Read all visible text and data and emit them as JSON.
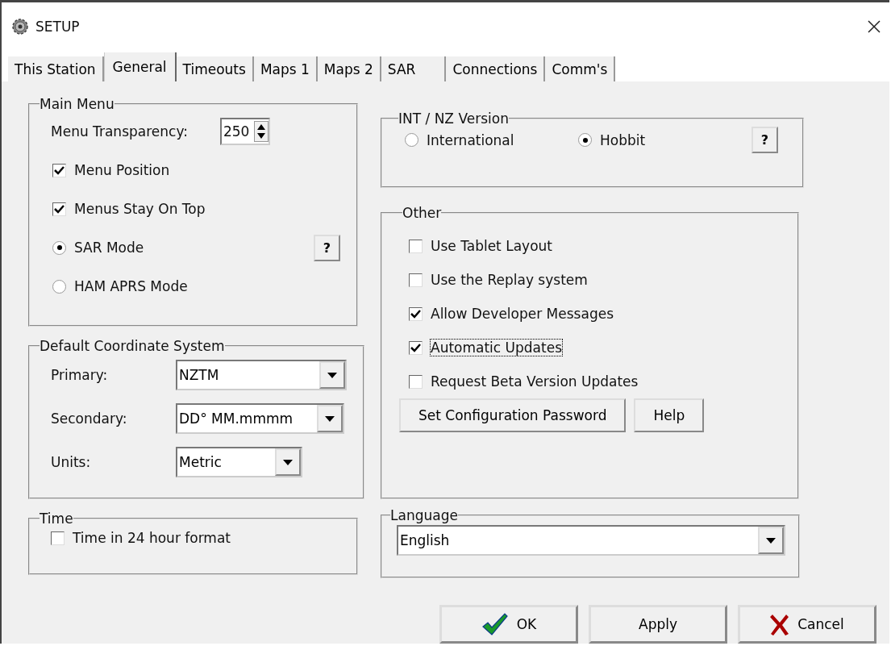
{
  "window": {
    "title": "SETUP"
  },
  "tabs": [
    {
      "label": "This Station",
      "selected": false
    },
    {
      "label": "General",
      "selected": true
    },
    {
      "label": "Timeouts",
      "selected": false
    },
    {
      "label": "Maps 1",
      "selected": false
    },
    {
      "label": "Maps 2",
      "selected": false
    },
    {
      "label": "SAR",
      "selected": false
    },
    {
      "label": "Connections",
      "selected": false
    },
    {
      "label": "Comm's",
      "selected": false
    }
  ],
  "main_menu": {
    "title": "Main Menu",
    "transparency": {
      "label": "Menu Transparency:",
      "value": "250"
    },
    "options": [
      {
        "kind": "checkbox",
        "label": "Menu Position",
        "checked": true
      },
      {
        "kind": "checkbox",
        "label": "Menus Stay On Top",
        "checked": true
      },
      {
        "kind": "radio",
        "label": "SAR Mode",
        "selected": true,
        "help": "?"
      },
      {
        "kind": "radio",
        "label": "HAM APRS Mode",
        "selected": false
      }
    ]
  },
  "coordinate_system": {
    "title": "Default Coordinate System",
    "fields": [
      {
        "label": "Primary:",
        "value": "NZTM"
      },
      {
        "label": "Secondary:",
        "value": "DD° MM.mmmm"
      },
      {
        "label": "Units:",
        "value": "Metric"
      }
    ]
  },
  "time": {
    "title": "Time",
    "options": [
      {
        "label": "Time in 24 hour format",
        "checked": false
      }
    ]
  },
  "version": {
    "title": "INT / NZ Version",
    "options": [
      {
        "label": "International",
        "selected": false
      },
      {
        "label": "Hobbit",
        "selected": true
      }
    ],
    "help": "?"
  },
  "other": {
    "title": "Other",
    "options": [
      {
        "label": "Use Tablet Layout",
        "checked": false,
        "focused": false
      },
      {
        "label": "Use the Replay system",
        "checked": false,
        "focused": false
      },
      {
        "label": "Allow Developer Messages",
        "checked": true,
        "focused": false
      },
      {
        "label": "Automatic Updates",
        "checked": true,
        "focused": true
      },
      {
        "label": "Request Beta Version Updates",
        "checked": false,
        "focused": false
      }
    ],
    "buttons": [
      "Set Configuration Password",
      "Help"
    ]
  },
  "language": {
    "title": "Language",
    "value": "English"
  },
  "buttons": [
    {
      "kind": "ok",
      "label": "OK"
    },
    {
      "kind": "apply",
      "label": "Apply"
    },
    {
      "kind": "cancel",
      "label": "Cancel"
    }
  ]
}
